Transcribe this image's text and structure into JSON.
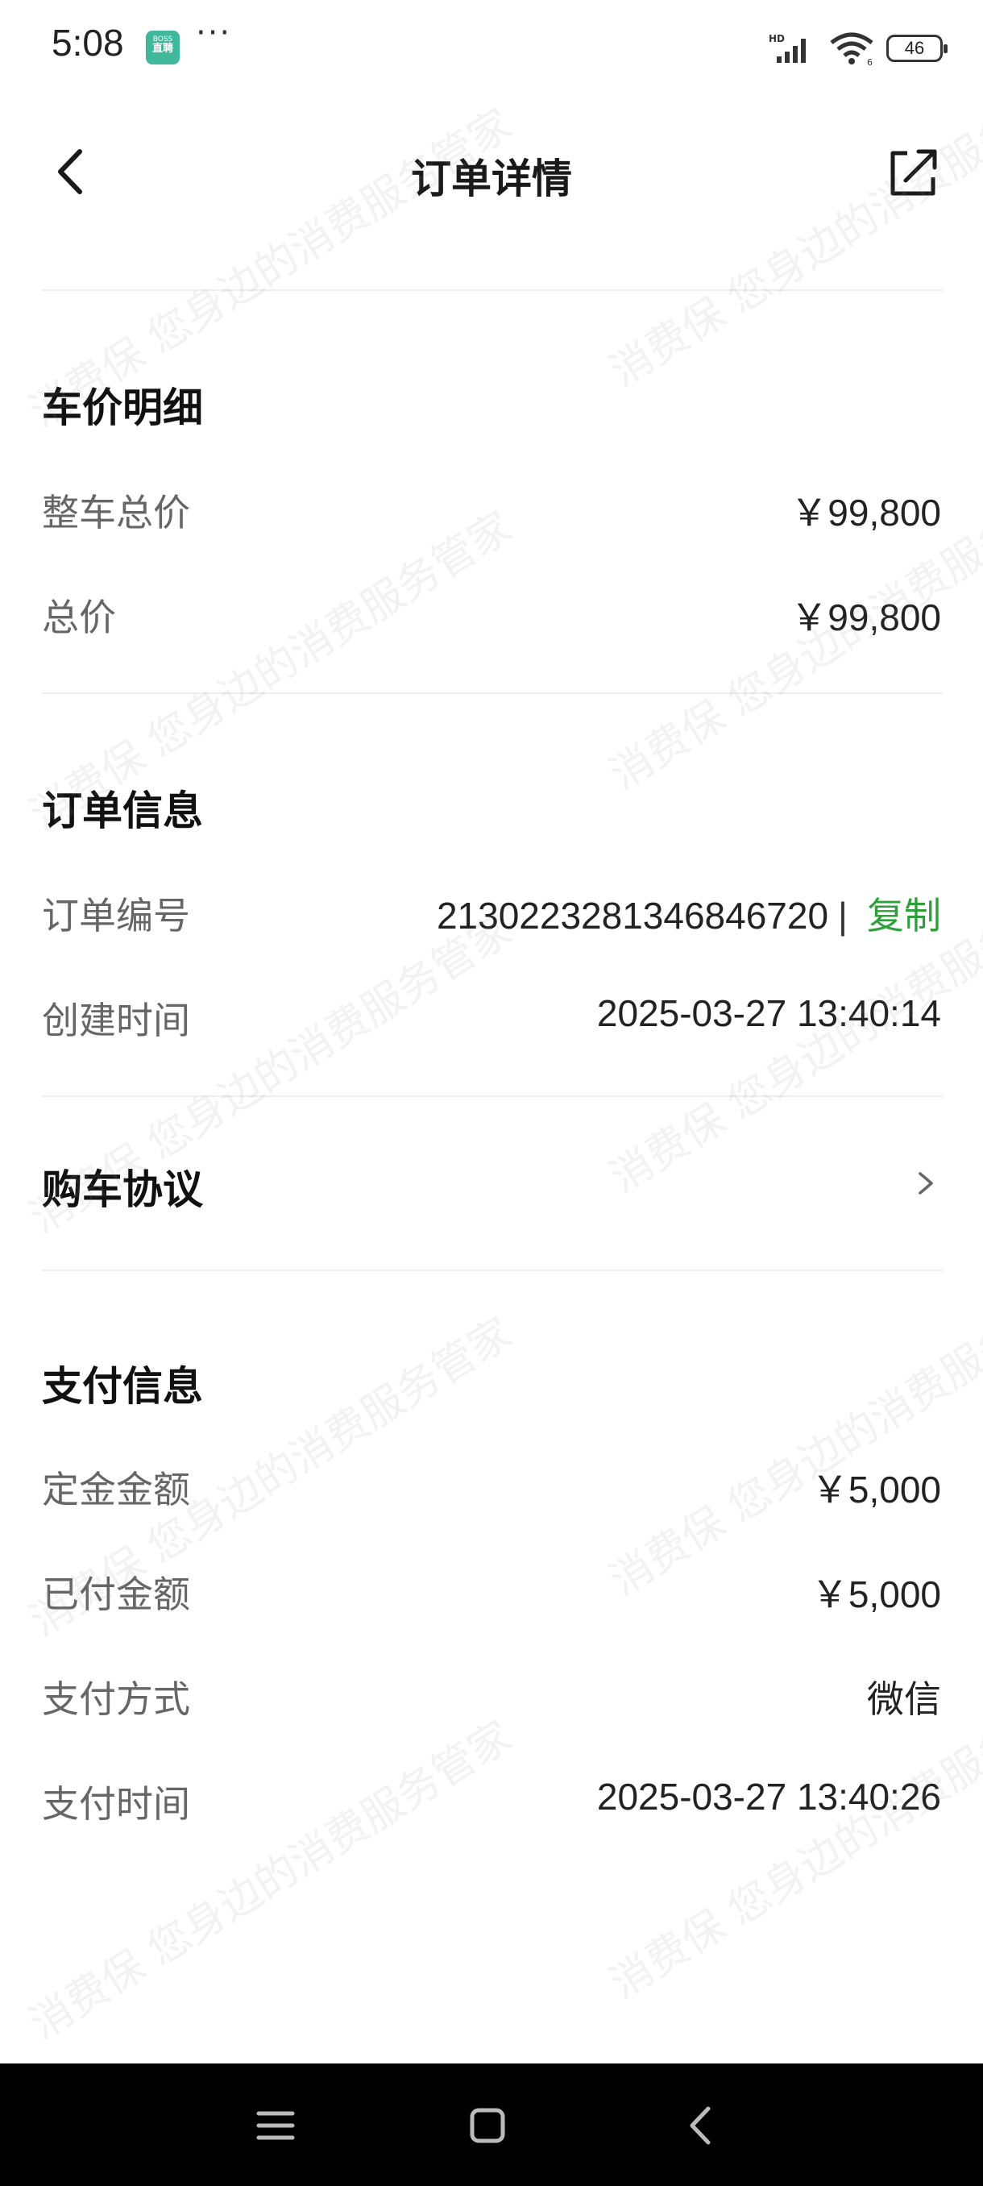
{
  "status_bar": {
    "time": "5:08",
    "app_badge_top": "BOSS",
    "app_badge_bottom": "直聘",
    "more": "···",
    "battery": "46",
    "icons": [
      "hd-signal-icon",
      "wifi-icon",
      "battery-icon"
    ]
  },
  "nav": {
    "title": "订单详情",
    "back_icon": "back-arrow-icon",
    "share_icon": "share-icon"
  },
  "price_section": {
    "title": "车价明细",
    "rows": [
      {
        "label": "整车总价",
        "value": "￥99,800"
      },
      {
        "label": "总价",
        "value": "￥99,800"
      }
    ]
  },
  "order_section": {
    "title": "订单信息",
    "order_no_label": "订单编号",
    "order_no": "2130223281346846720",
    "separator": "|",
    "copy": "复制",
    "created_label": "创建时间",
    "created_value": "2025-03-27 13:40:14"
  },
  "agreement": {
    "title": "购车协议"
  },
  "payment_section": {
    "title": "支付信息",
    "rows": [
      {
        "label": "定金金额",
        "value": "￥5,000"
      },
      {
        "label": "已付金额",
        "value": "￥5,000"
      },
      {
        "label": "支付方式",
        "value": "微信"
      },
      {
        "label": "支付时间",
        "value": "2025-03-27 13:40:26"
      }
    ]
  },
  "watermark": {
    "text": "消费保 您身边的消费服务管家"
  },
  "colors": {
    "accent_green": "#2e9f3a",
    "label_gray": "#666666",
    "divider": "#eeeeee"
  }
}
